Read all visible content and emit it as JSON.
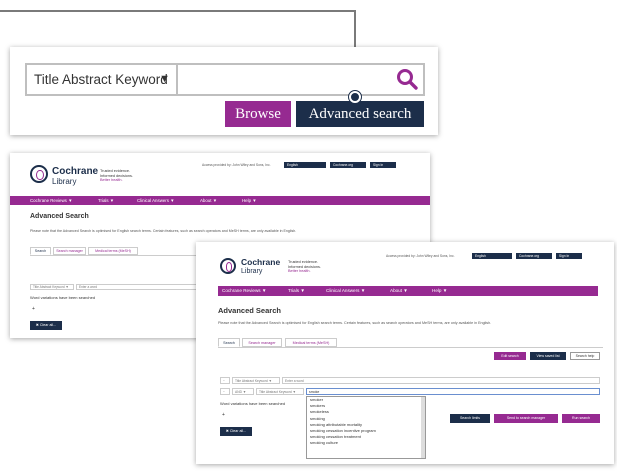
{
  "search_panel": {
    "field_select": "Title Abstract Keyword",
    "browse": "Browse",
    "advanced_search": "Advanced search"
  },
  "site": {
    "logo_title": "Cochrane",
    "logo_sub": "Library",
    "tagline": [
      "Trusted evidence.",
      "Informed decisions.",
      "Better health."
    ],
    "access": "Access provided by: John Wiley and Sons, Inc.",
    "language": "English",
    "cochrane_org": "Cochrane.org",
    "sign_in": "Sign In",
    "nav": [
      "Cochrane Reviews ▼",
      "Trials ▼",
      "Clinical Answers ▼",
      "About ▼",
      "Help ▼"
    ],
    "heading": "Advanced Search",
    "note": "Please note that the Advanced Search is optimised for English search terms. Certain features, such as search operators and MeSH terms, are only available in English.",
    "tabs": [
      "Search",
      "Search manager",
      "Medical terms (MeSH)"
    ],
    "field_default": "Title Abstract Keyword ▼",
    "enter_word": "Enter a word",
    "word_variations": "Word variations have been searched",
    "clear_all": "✖ Clear all..."
  },
  "front": {
    "top_buttons": [
      "Edit search",
      "View saved list",
      "Search help"
    ],
    "operator": "AND ▼",
    "typed": "smoke",
    "suggestions": [
      "smoker",
      "smokers",
      "smokeless",
      "smoking",
      "smoking attributable mortality",
      "smoking cessation incentive program",
      "smoking cessation treatment",
      "smoking culture"
    ],
    "action_buttons": [
      "Search limits",
      "Send to search manager",
      "Run search"
    ]
  },
  "colors": {
    "purple": "#962a91",
    "navy": "#1c2e4a",
    "grey": "#7a7a7a"
  }
}
